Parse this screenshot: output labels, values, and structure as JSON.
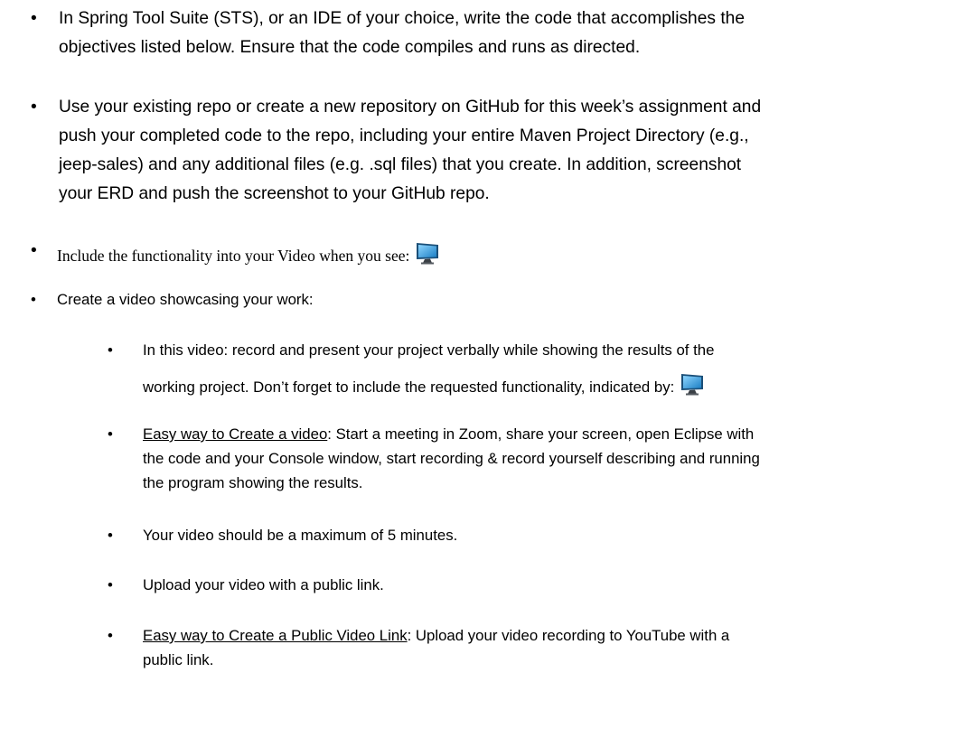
{
  "bullets": {
    "b1": {
      "line1": "In Spring Tool Suite (STS), or an IDE of your choice, write the code that accomplishes the",
      "line2": "objectives listed below. Ensure that the code compiles and runs as directed."
    },
    "b2": {
      "line1": "Use your existing repo or create a new repository on GitHub for this week’s assignment and",
      "line2": "push your completed code to the repo, including your entire Maven Project Directory (e.g.,",
      "line3": "jeep-sales) and any additional files (e.g. .sql files) that you create.  In addition, screenshot",
      "line4": "your ERD and push the screenshot to your GitHub repo."
    },
    "b3": {
      "text": "Include the functionality into your Video when you see:",
      "icon": "monitor-icon"
    },
    "b4": {
      "text": "Create a video showcasing your work:"
    }
  },
  "subbullets": {
    "s1": {
      "line1": "In this video: record and present your project verbally while showing the results of the",
      "line2": "working project.   Don’t forget to include the requested functionality, indicated by:",
      "icon": "monitor-icon"
    },
    "s2": {
      "label": "Easy way to Create a video",
      "line1_rest": ":  Start a meeting in Zoom, share your screen, open Eclipse with",
      "line2": "the code and your Console window, start recording & record yourself describing and running",
      "line3": "the program showing the results."
    },
    "s3": {
      "text": "Your video should be a maximum of 5 minutes."
    },
    "s4": {
      "text": "Upload your video with a public link."
    },
    "s5": {
      "label": "Easy way to Create a Public Video Link",
      "line1_rest": ":  Upload your video recording to YouTube with a",
      "line2": "public link."
    }
  },
  "bullet_char": "•",
  "colors": {
    "text": "#000000",
    "monitor_frame": "#1b6fa8",
    "monitor_screen": "#3fa9e6"
  }
}
